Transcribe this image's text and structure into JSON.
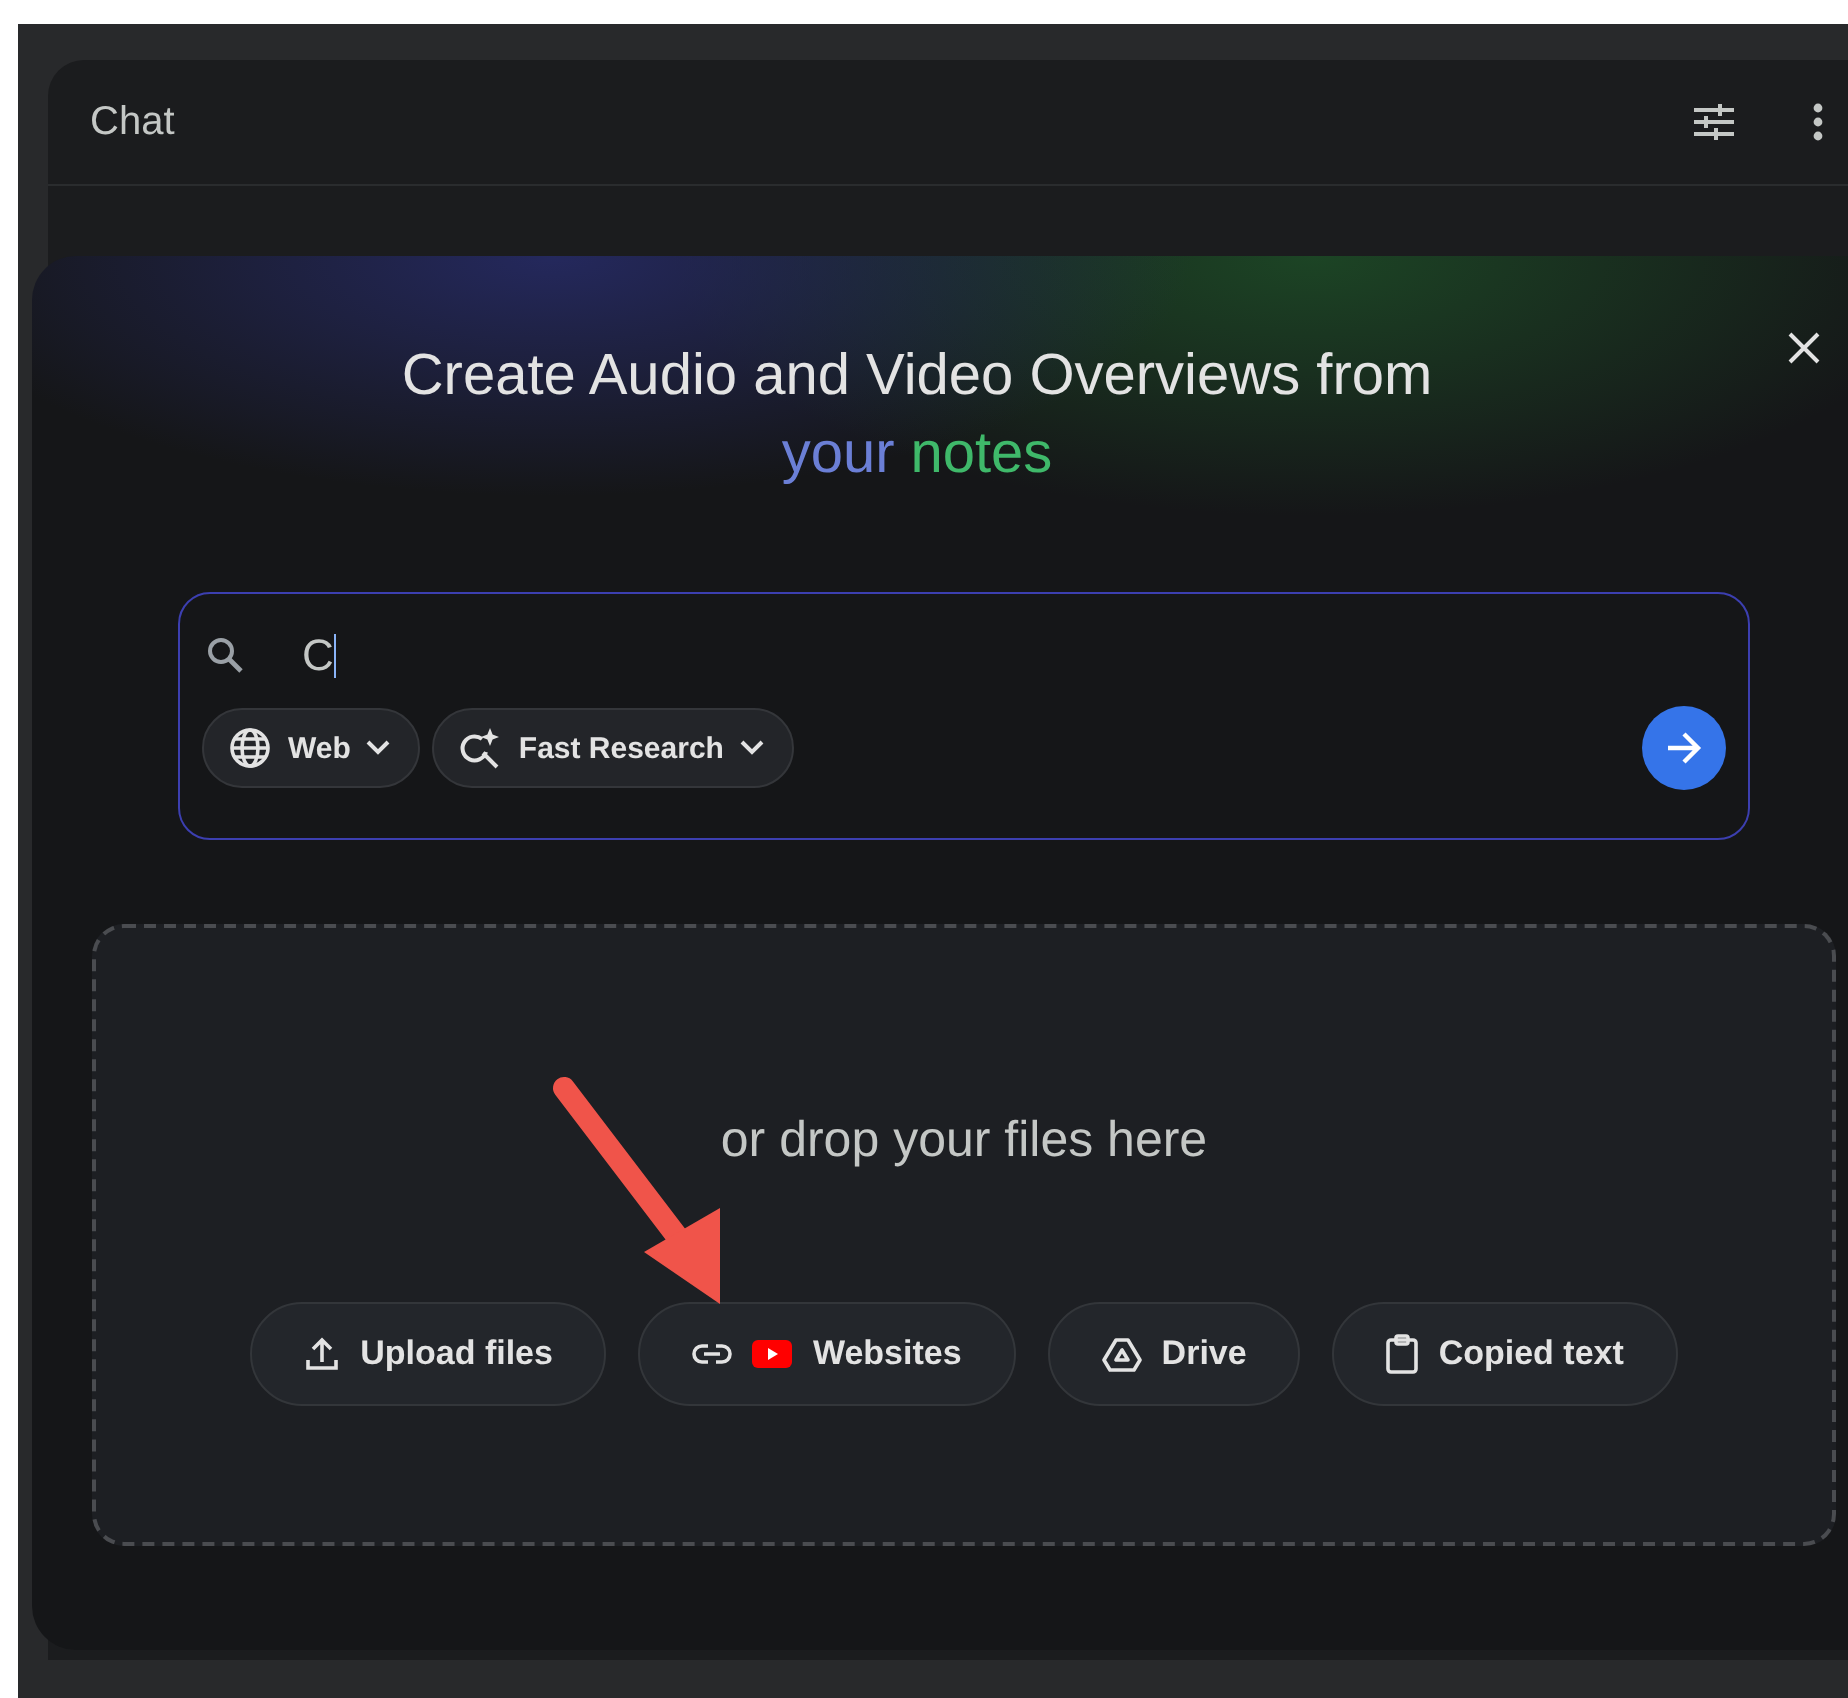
{
  "chat_panel": {
    "title": "Chat"
  },
  "dialog": {
    "title": "Create Audio and Video Overviews from",
    "title_accent": [
      {
        "text": "your",
        "color": "#6b7fd6"
      },
      {
        "text": "notes",
        "color": "#3fb96a"
      }
    ],
    "search": {
      "value": "C",
      "chips": [
        {
          "kind": "web",
          "label": "Web"
        },
        {
          "kind": "research",
          "label": "Fast Research"
        }
      ]
    },
    "drop_zone": {
      "prompt": "or drop your files here",
      "buttons": [
        {
          "kind": "upload",
          "label": "Upload files"
        },
        {
          "kind": "websites",
          "label": "Websites"
        },
        {
          "kind": "drive",
          "label": "Drive"
        },
        {
          "kind": "clipboard",
          "label": "Copied text"
        }
      ]
    }
  }
}
